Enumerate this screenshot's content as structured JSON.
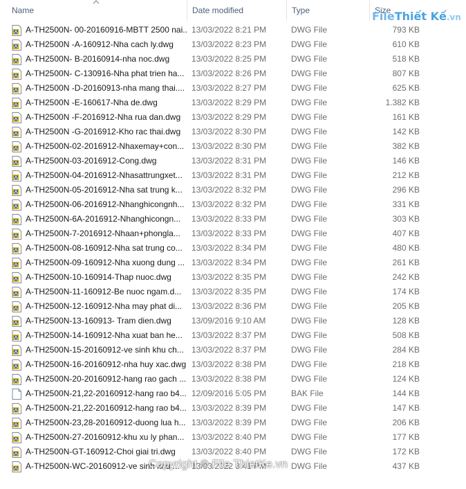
{
  "columns": {
    "name": "Name",
    "date": "Date modified",
    "type": "Type",
    "size": "Size"
  },
  "logo": {
    "part1": "File",
    "part2": "Thiết Kế",
    "part3": ".vn"
  },
  "watermark": "Copyright © File ThietKe.vn",
  "files": [
    {
      "name": "A-TH2500N- 00-20160916-MBTT 2500 nai....",
      "date": "13/03/2022 8:21 PM",
      "type": "DWG File",
      "size": "793 KB",
      "icon": "dwg-file-icon"
    },
    {
      "name": "A-TH2500N -A-160912-Nha cach ly.dwg",
      "date": "13/03/2022 8:23 PM",
      "type": "DWG File",
      "size": "610 KB",
      "icon": "dwg-file-icon"
    },
    {
      "name": "A-TH2500N- B-20160914-nha noc.dwg",
      "date": "13/03/2022 8:25 PM",
      "type": "DWG File",
      "size": "518 KB",
      "icon": "dwg-file-icon"
    },
    {
      "name": "A-TH2500N- C-130916-Nha phat trien ha...",
      "date": "13/03/2022 8:26 PM",
      "type": "DWG File",
      "size": "807 KB",
      "icon": "dwg-file-icon"
    },
    {
      "name": "A-TH2500N -D-20160913-nha mang thai....",
      "date": "13/03/2022 8:27 PM",
      "type": "DWG File",
      "size": "625 KB",
      "icon": "dwg-file-icon"
    },
    {
      "name": "A-TH2500N -E-160617-Nha de.dwg",
      "date": "13/03/2022 8:29 PM",
      "type": "DWG File",
      "size": "1.382 KB",
      "icon": "dwg-file-icon"
    },
    {
      "name": "A-TH2500N -F-2016912-Nha rua dan.dwg",
      "date": "13/03/2022 8:29 PM",
      "type": "DWG File",
      "size": "161 KB",
      "icon": "dwg-file-icon"
    },
    {
      "name": "A-TH2500N -G-2016912-Kho rac thai.dwg",
      "date": "13/03/2022 8:30 PM",
      "type": "DWG File",
      "size": "142 KB",
      "icon": "dwg-file-icon"
    },
    {
      "name": "A-TH2500N-02-2016912-Nhaxemay+con...",
      "date": "13/03/2022 8:30 PM",
      "type": "DWG File",
      "size": "382 KB",
      "icon": "dwg-file-icon"
    },
    {
      "name": "A-TH2500N-03-2016912-Cong.dwg",
      "date": "13/03/2022 8:31 PM",
      "type": "DWG File",
      "size": "146 KB",
      "icon": "dwg-file-icon"
    },
    {
      "name": "A-TH2500N-04-2016912-Nhasattrungxet...",
      "date": "13/03/2022 8:31 PM",
      "type": "DWG File",
      "size": "212 KB",
      "icon": "dwg-file-icon"
    },
    {
      "name": "A-TH2500N-05-2016912-Nha sat trung k...",
      "date": "13/03/2022 8:32 PM",
      "type": "DWG File",
      "size": "296 KB",
      "icon": "dwg-file-icon"
    },
    {
      "name": "A-TH2500N-06-2016912-Nhanghicongnh...",
      "date": "13/03/2022 8:32 PM",
      "type": "DWG File",
      "size": "331 KB",
      "icon": "dwg-file-icon"
    },
    {
      "name": "A-TH2500N-6A-2016912-Nhanghicongn...",
      "date": "13/03/2022 8:33 PM",
      "type": "DWG File",
      "size": "303 KB",
      "icon": "dwg-file-icon"
    },
    {
      "name": "A-TH2500N-7-2016912-Nhaan+phongla...",
      "date": "13/03/2022 8:33 PM",
      "type": "DWG File",
      "size": "407 KB",
      "icon": "dwg-file-icon"
    },
    {
      "name": "A-TH2500N-08-160912-Nha sat trung co...",
      "date": "13/03/2022 8:34 PM",
      "type": "DWG File",
      "size": "480 KB",
      "icon": "dwg-file-icon"
    },
    {
      "name": "A-TH2500N-09-160912-Nha xuong dung ...",
      "date": "13/03/2022 8:34 PM",
      "type": "DWG File",
      "size": "261 KB",
      "icon": "dwg-file-icon"
    },
    {
      "name": "A-TH2500N-10-160914-Thap nuoc.dwg",
      "date": "13/03/2022 8:35 PM",
      "type": "DWG File",
      "size": "242 KB",
      "icon": "dwg-file-icon"
    },
    {
      "name": "A-TH2500N-11-160912-Be nuoc ngam.d...",
      "date": "13/03/2022 8:35 PM",
      "type": "DWG File",
      "size": "174 KB",
      "icon": "dwg-file-icon"
    },
    {
      "name": "A-TH2500N-12-160912-Nha may phat di...",
      "date": "13/03/2022 8:36 PM",
      "type": "DWG File",
      "size": "205 KB",
      "icon": "dwg-file-icon"
    },
    {
      "name": "A-TH2500N-13-160913- Tram dien.dwg",
      "date": "13/09/2016 9:10 AM",
      "type": "DWG File",
      "size": "128 KB",
      "icon": "dwg-file-icon"
    },
    {
      "name": "A-TH2500N-14-160912-Nha xuat ban he...",
      "date": "13/03/2022 8:37 PM",
      "type": "DWG File",
      "size": "508 KB",
      "icon": "dwg-file-icon"
    },
    {
      "name": "A-TH2500N-15-20160912-ve sinh khu ch...",
      "date": "13/03/2022 8:37 PM",
      "type": "DWG File",
      "size": "284 KB",
      "icon": "dwg-file-icon"
    },
    {
      "name": "A-TH2500N-16-20160912-nha huy xac.dwg",
      "date": "13/03/2022 8:38 PM",
      "type": "DWG File",
      "size": "218 KB",
      "icon": "dwg-file-icon"
    },
    {
      "name": "A-TH2500N-20-20160912-hang rao gach ...",
      "date": "13/03/2022 8:38 PM",
      "type": "DWG File",
      "size": "124 KB",
      "icon": "dwg-file-icon"
    },
    {
      "name": "A-TH2500N-21,22-20160912-hang rao b4...",
      "date": "12/09/2016 5:05 PM",
      "type": "BAK File",
      "size": "144 KB",
      "icon": "bak-file-icon"
    },
    {
      "name": "A-TH2500N-21,22-20160912-hang rao b4...",
      "date": "13/03/2022 8:39 PM",
      "type": "DWG File",
      "size": "147 KB",
      "icon": "dwg-file-icon"
    },
    {
      "name": "A-TH2500N-23,28-20160912-duong lua h...",
      "date": "13/03/2022 8:39 PM",
      "type": "DWG File",
      "size": "206 KB",
      "icon": "dwg-file-icon"
    },
    {
      "name": "A-TH2500N-27-20160912-khu xu ly phan...",
      "date": "13/03/2022 8:40 PM",
      "type": "DWG File",
      "size": "177 KB",
      "icon": "dwg-file-icon"
    },
    {
      "name": "A-TH2500N-GT-160912-Choi giai tri.dwg",
      "date": "13/03/2022 8:40 PM",
      "type": "DWG File",
      "size": "172 KB",
      "icon": "dwg-file-icon"
    },
    {
      "name": "A-TH2500N-WC-20160912-ve sinh khu ...",
      "date": "13/03/2022 8:41 PM",
      "type": "DWG File",
      "size": "437 KB",
      "icon": "dwg-file-icon"
    }
  ]
}
